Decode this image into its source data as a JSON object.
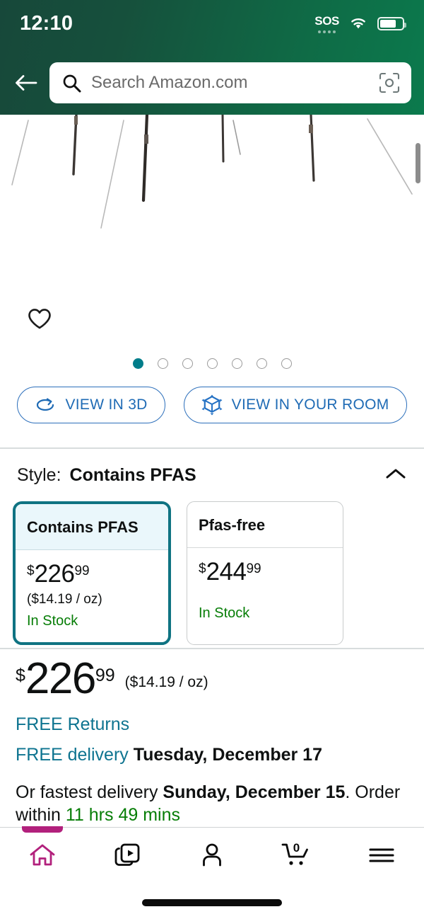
{
  "status_bar": {
    "time": "12:10",
    "sos_label": "SOS",
    "wifi_icon": "wifi-icon",
    "battery_icon": "battery-icon"
  },
  "header": {
    "back_icon": "back-arrow-icon",
    "search": {
      "placeholder": "Search Amazon.com",
      "search_icon": "search-icon",
      "camera_icon": "camera-lens-icon"
    },
    "accent_green_dark": "#17483a",
    "accent_green_light": "#0b7a4d"
  },
  "gallery": {
    "wishlist_icon": "heart-icon",
    "scrollbar": "vertical-scrollbar",
    "dot_count": 7,
    "active_dot_index": 0,
    "active_dot_color": "#007d8a",
    "view_3d": {
      "label": "VIEW IN 3D",
      "icon": "rotate-3d-icon"
    },
    "view_room": {
      "label": "VIEW IN YOUR ROOM",
      "icon": "ar-cube-icon"
    },
    "link_color": "#1f6bb5"
  },
  "style_section": {
    "label": "Style:",
    "selected_value": "Contains PFAS",
    "collapse_icon": "chevron-up-icon",
    "selected_border_color": "#0f7382",
    "options": [
      {
        "title": "Contains PFAS",
        "currency": "$",
        "whole": "226",
        "fraction": "99",
        "unit_price": "($14.19 / oz)",
        "stock": "In Stock",
        "selected": true
      },
      {
        "title": "Pfas-free",
        "currency": "$",
        "whole": "244",
        "fraction": "99",
        "unit_price": "",
        "stock": "In Stock",
        "selected": false
      }
    ]
  },
  "price_block": {
    "currency": "$",
    "whole": "226",
    "fraction": "99",
    "unit_price": "($14.19 / oz)",
    "free_returns": "FREE Returns",
    "free_delivery_prefix": "FREE delivery",
    "free_delivery_date": "Tuesday, December 17",
    "fastest_prefix": "Or fastest delivery",
    "fastest_date": "Sunday, December 15",
    "fastest_mid": ". Order within",
    "fastest_countdown": "11 hrs 49 mins",
    "link_color": "#0e7490",
    "stock_green": "#067d06"
  },
  "bottom_nav": {
    "active_color": "#b2207c",
    "items": [
      {
        "name": "home",
        "icon": "home-icon",
        "active": true
      },
      {
        "name": "media",
        "icon": "video-stack-icon",
        "active": false
      },
      {
        "name": "account",
        "icon": "person-icon",
        "active": false
      },
      {
        "name": "cart",
        "icon": "shopping-cart-icon",
        "badge": "0",
        "active": false
      },
      {
        "name": "menu",
        "icon": "hamburger-menu-icon",
        "active": false
      }
    ]
  }
}
